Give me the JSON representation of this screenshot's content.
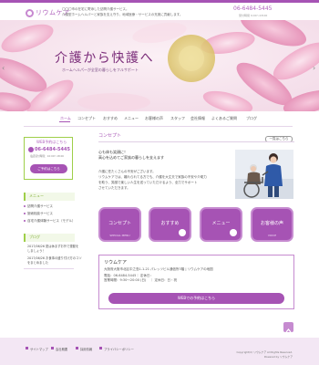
{
  "header": {
    "logo_text": "リウムケア",
    "tagline_line1": "〇〇〇市の在宅に寄添した訪問介護サービス。",
    "tagline_line2": "介護型ホームヘルパーと家族を支え守り、地域医療・サービスの充実に貢献します。",
    "phone": "06-6484-5445",
    "hours": "受付時間 9:00〜18:00"
  },
  "hero": {
    "title": "介護から快護へ",
    "subtitle": "ホームヘルパーが全室の暮らしをフルサポート",
    "prev_label": "‹",
    "next_label": "›"
  },
  "nav": {
    "items": [
      "ホーム",
      "コンセプト",
      "おすすめ",
      "メニュー",
      "お客様の声",
      "スタッフ",
      "会社情報",
      "よくあるご質問",
      "ブログ"
    ]
  },
  "sidebar": {
    "reserve_heading": "WEB予約はこちら",
    "phone": "06-6484-5445",
    "hours": "電話受付時間：10:00〜18:00",
    "reserve_button": "ご予約はこちら",
    "menu_heading": "メニュー",
    "menu_items": [
      "訪問介護サービス",
      "施術相談サービス",
      "自宅介護体験サービス（モデル）"
    ],
    "blog_heading": "ブログ",
    "blog_posts": [
      {
        "line1": "2017/06/26 夏は休まずお外で運動を",
        "line2": "しましょう！"
      },
      {
        "line1": "2017/06/26 お食事の盛り付け方のコツ",
        "line2": "をまとめました"
      }
    ]
  },
  "concept": {
    "title": "コンセプト",
    "list_button": "一覧はこちら",
    "headline_line1": "心も体も笑顔に！",
    "headline_line2": "高心を込めてご家族の暮らしを支えます",
    "body_line1": "介護に任たくさんの不安がございます。",
    "body_line2": "リウムケアでは、離れられてる方でも、介護を大丈夫で家族の不安や介助力",
    "body_line3": "を助う、笑顔で楽しい人生を送っていただけるよう、全力でサポート",
    "body_line4": "させていただきます。"
  },
  "tiles": [
    {
      "label": "コンセプト",
      "sub": "SPECIAL MENU"
    },
    {
      "label": "おすすめ",
      "sub": ""
    },
    {
      "label": "メニュー",
      "sub": ""
    },
    {
      "label": "お客様の声",
      "sub": "VOICE"
    }
  ],
  "clinic": {
    "name": "リウムケア",
    "address": "大阪府大阪市北区中之島1-1-21 パレッツビル通信所3階 | リウムケアの地図",
    "tel_label": "電話：",
    "phone": "06-6484-5445",
    "hours_label": "｜ 定休日：",
    "time_line": "営業時間：9:30〜20:00 (日)　 ｜ 定休日：日・祝",
    "reserve_button": "WEBでの予約はこちら"
  },
  "footer": {
    "links": [
      "サイトマップ",
      "会社概要",
      "採用情報",
      "プライバシーポリシー"
    ],
    "copyright_line1": "Copyright(C) リウムケア All Rights Reserved.",
    "copyright_line2": "Powered by リウムケア"
  },
  "colors": {
    "accent": "#a653b4",
    "accent_light": "#c68bd0",
    "green": "#9fcf49",
    "footer_bg": "#f3e7f4"
  }
}
